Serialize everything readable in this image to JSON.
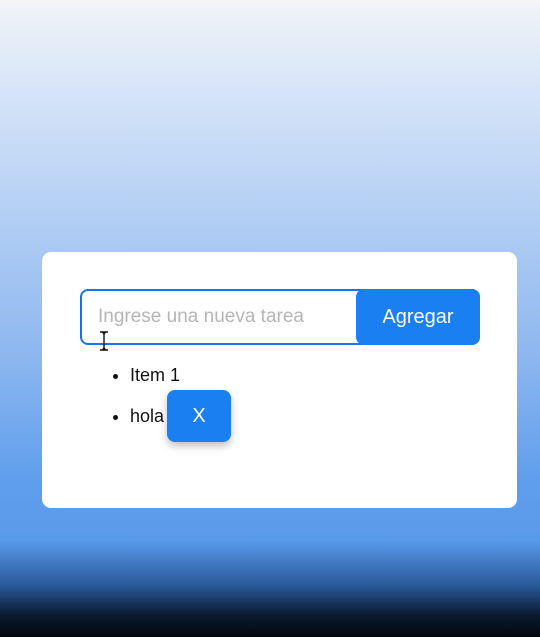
{
  "form": {
    "input_value": "",
    "input_placeholder": "Ingrese una nueva tarea",
    "add_label": "Agregar"
  },
  "tasks": [
    {
      "label": "Item 1",
      "has_delete": false
    },
    {
      "label": "hola",
      "has_delete": true,
      "delete_label": "X"
    }
  ],
  "colors": {
    "accent": "#1a7ff0",
    "card": "#ffffff"
  },
  "icons": {
    "cursor": "text-cursor-icon"
  }
}
